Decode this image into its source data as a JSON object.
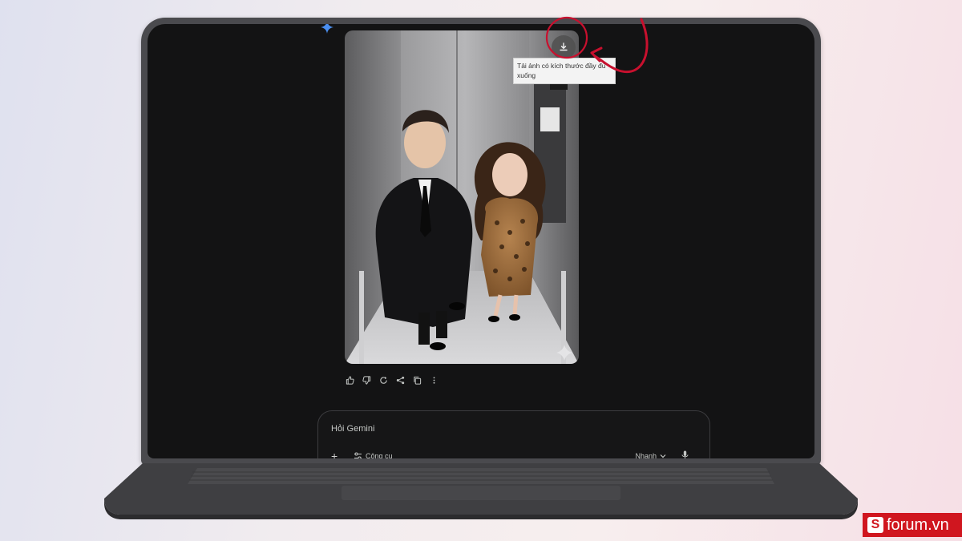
{
  "tooltip": {
    "text": "Tải ảnh có kích thước đầy đủ xuống"
  },
  "prompt": {
    "placeholder": "Hỏi Gemini",
    "add_label": "+",
    "tools_label": "Công cụ",
    "model_label": "Nhanh"
  },
  "actions": [
    {
      "name": "thumbs-up-icon"
    },
    {
      "name": "thumbs-down-icon"
    },
    {
      "name": "regenerate-icon"
    },
    {
      "name": "share-icon"
    },
    {
      "name": "copy-icon"
    },
    {
      "name": "more-options-icon"
    }
  ],
  "watermark": {
    "brand_text": "forum.vn",
    "brand_mark": "S"
  },
  "colors": {
    "screen_bg": "#131314",
    "annotation": "#c8102e",
    "gemini_accent": "#4a8ef0",
    "brand": "#d0161f"
  }
}
